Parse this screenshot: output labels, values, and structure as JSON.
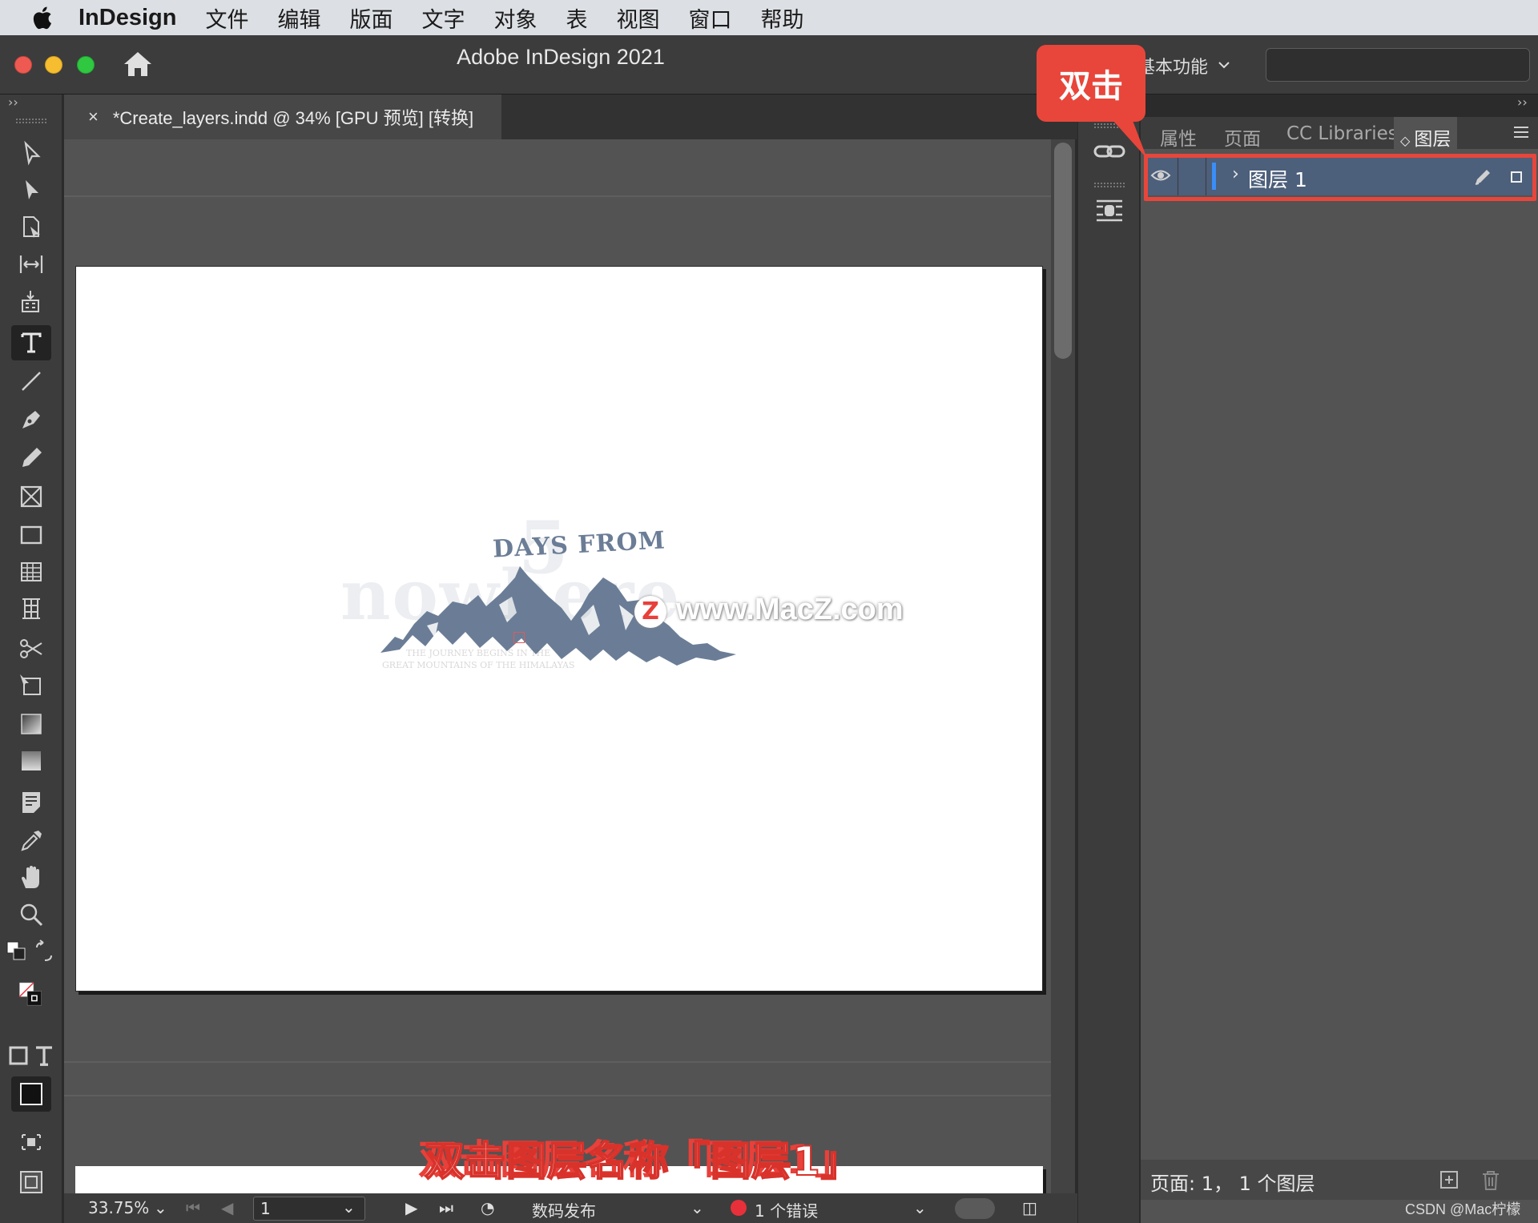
{
  "menubar": {
    "app_name": "InDesign",
    "items": [
      "文件",
      "编辑",
      "版面",
      "文字",
      "对象",
      "表",
      "视图",
      "窗口",
      "帮助"
    ]
  },
  "window": {
    "title": "Adobe InDesign 2021",
    "workspace": "基本功能",
    "search_placeholder": ""
  },
  "document": {
    "tab_label": "*Create_layers.indd @ 34% [GPU 预览] [转换]",
    "close_glyph": "×"
  },
  "artwork": {
    "big_number": "5",
    "line1": "DAYS FROM",
    "line2": "nowhere",
    "tagline1": "THE JOURNEY BEGINS IN THE",
    "tagline2": "GREAT MOUNTAINS OF THE HIMALAYAS",
    "art_color": "#6b7d96"
  },
  "watermark": {
    "text": "www.MacZ.com",
    "logo_letter": "Z"
  },
  "panel": {
    "tabs": [
      "属性",
      "页面",
      "CC Libraries",
      "图层"
    ],
    "active_tab": "图层",
    "layers": [
      {
        "name": "图层 1",
        "color": "#3a8ef6",
        "visible": true
      }
    ],
    "footer": "页面: 1， 1 个图层"
  },
  "annotation": {
    "callout": "双击",
    "caption": "双击图层名称「图层1」",
    "highlight_color": "#e8463b"
  },
  "statusbar": {
    "zoom": "33.75%",
    "page": "1",
    "preflight_profile": "数码发布",
    "errors": "1 个错误"
  },
  "credit": "CSDN @Mac柠檬",
  "icons": [
    "apple-icon",
    "home-icon",
    "selection-tool-icon",
    "direct-selection-tool-icon",
    "page-tool-icon",
    "gap-tool-icon",
    "content-collector-icon",
    "type-tool-icon",
    "line-tool-icon",
    "pen-tool-icon",
    "pencil-tool-icon",
    "rectangle-frame-tool-icon",
    "rectangle-tool-icon",
    "table-tool-icon",
    "grid-tool-icon",
    "scissors-tool-icon",
    "free-transform-tool-icon",
    "gradient-swatch-tool-icon",
    "gradient-feather-tool-icon",
    "note-tool-icon",
    "eyedropper-tool-icon",
    "hand-tool-icon",
    "zoom-tool-icon",
    "links-icon",
    "text-wrap-icon",
    "eye-icon",
    "pencil-icon",
    "new-layer-icon",
    "trash-icon"
  ]
}
